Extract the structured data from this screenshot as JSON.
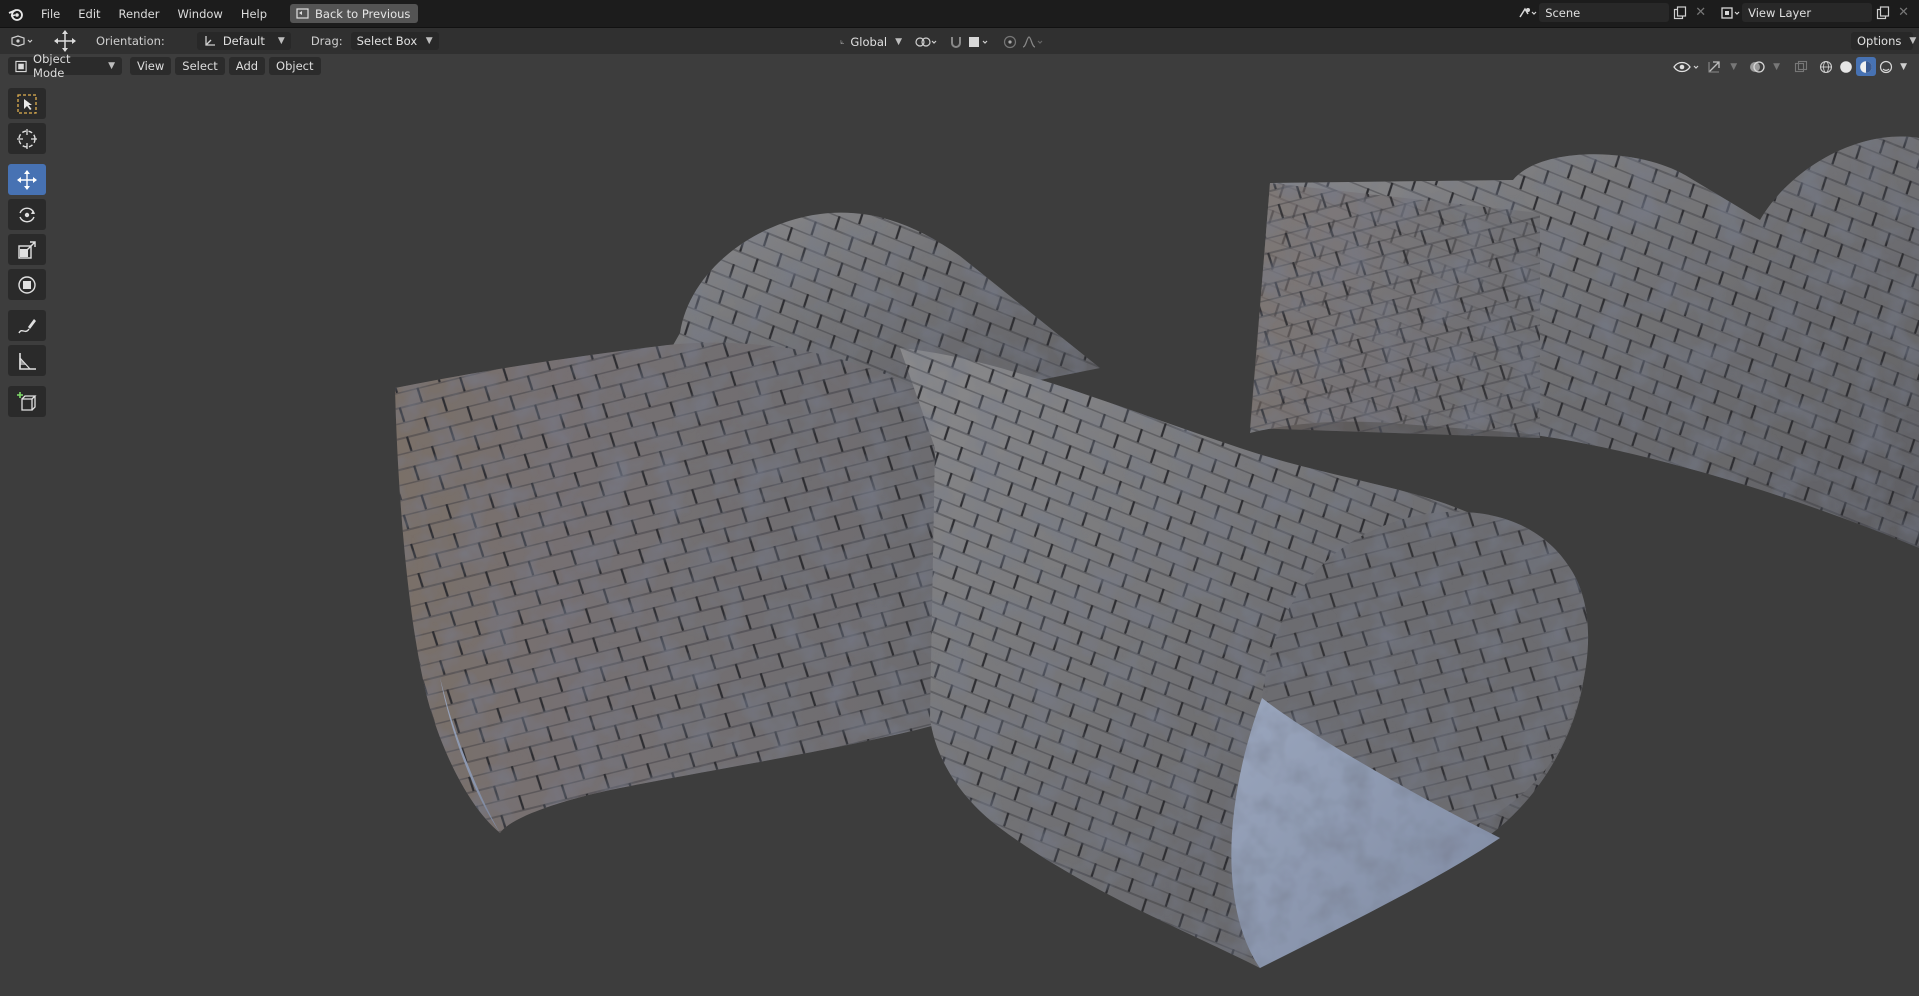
{
  "menubar": {
    "items": [
      "File",
      "Edit",
      "Render",
      "Window",
      "Help"
    ],
    "back_button": "Back to Previous"
  },
  "topright": {
    "scene": "Scene",
    "view_layer": "View Layer"
  },
  "toolheader": {
    "orientation_label": "Orientation:",
    "orientation_value": "Default",
    "drag_label": "Drag:",
    "drag_value": "Select Box",
    "transform_orientation": "Global",
    "options": "Options"
  },
  "viewheader": {
    "mode": "Object Mode",
    "menus": [
      "View",
      "Select",
      "Add",
      "Object"
    ]
  },
  "toolbar": {
    "tools": [
      "select-box-icon",
      "cursor-icon",
      "move-icon",
      "rotate-icon",
      "scale-icon",
      "transform-icon",
      "annotate-icon",
      "measure-icon",
      "add-cube-icon"
    ],
    "active": "move-icon"
  },
  "colors": {
    "accent": "#4772b3",
    "background": "#3d3d3d",
    "topbar": "#1c1c1c"
  }
}
